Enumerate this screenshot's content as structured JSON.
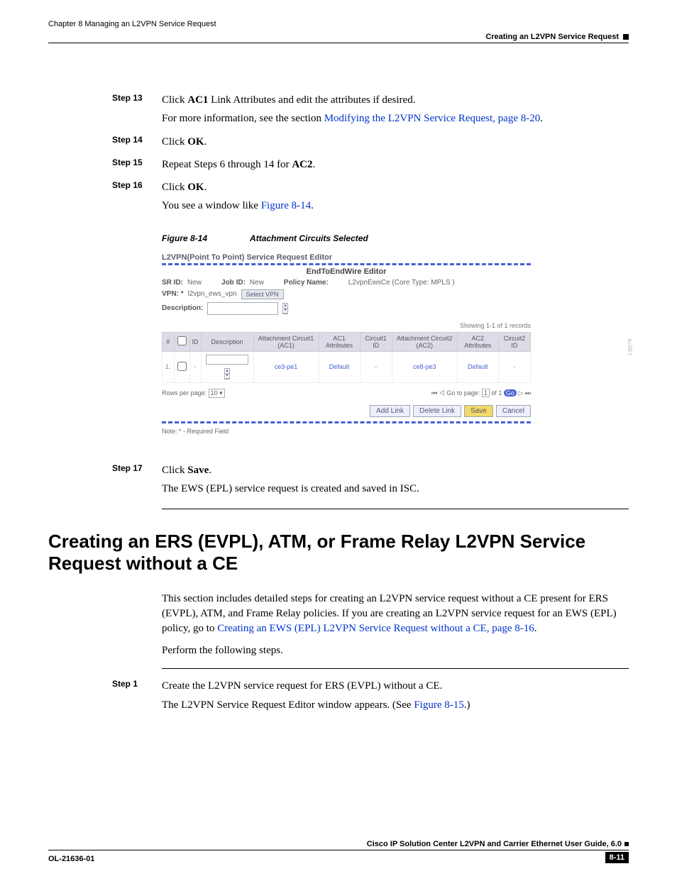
{
  "header": {
    "chapter": "Chapter 8      Managing an L2VPN Service Request",
    "section": "Creating an L2VPN Service Request"
  },
  "steps": {
    "s13": {
      "label": "Step 13",
      "line1a": "Click ",
      "bold1": "AC1",
      "line1b": " Link Attributes and edit the attributes if desired.",
      "line2a": "For more information, see the section ",
      "link": "Modifying the L2VPN Service Request, page 8-20",
      "line2b": "."
    },
    "s14": {
      "label": "Step 14",
      "txt": "Click ",
      "bold": "OK",
      "end": "."
    },
    "s15": {
      "label": "Step 15",
      "txt": "Repeat Steps 6 through 14 for ",
      "bold": "AC2",
      "end": "."
    },
    "s16": {
      "label": "Step 16",
      "txt": "Click ",
      "bold": "OK",
      "end": ".",
      "line2a": "You see a window like ",
      "link": "Figure 8-14",
      "line2b": "."
    },
    "s17": {
      "label": "Step 17",
      "txt": "Click ",
      "bold": "Save",
      "end": ".",
      "line2": "The EWS (EPL) service request is created and saved in ISC."
    },
    "sa1": {
      "label": "Step 1",
      "line1": "Create the L2VPN service request for ERS (EVPL) without a CE.",
      "line2a": "The L2VPN Service Request Editor window appears. (See ",
      "link": "Figure 8-15",
      "line2b": ".)"
    }
  },
  "figure": {
    "caption_no": "Figure 8-14",
    "caption_title": "Attachment Circuits Selected",
    "title": "L2VPN(Point To Point) Service Request Editor",
    "wire": "EndToEndWire Editor",
    "srid_l": "SR ID:",
    "srid_v": "New",
    "jobid_l": "Job ID:",
    "jobid_v": "New",
    "policy_l": "Policy Name:",
    "policy_v": "L2vpnEwsCe (Core Type: MPLS )",
    "vpn_l": "VPN: *",
    "vpn_v": "l2vpn_ews_vpn",
    "vpn_btn": "Select VPN",
    "desc_l": "Description:",
    "showing": "Showing 1-1 of 1 records",
    "th": {
      "h1": "#",
      "h2": "",
      "h3": "ID",
      "h4": "Description",
      "h5": "Attachment Circuit1 (AC1)",
      "h6": "AC1 Attributes",
      "h7": "Circuit1 ID",
      "h8": "Attachment Circuit2 (AC2)",
      "h9": "AC2 Attributes",
      "h10": "Circuit2 ID"
    },
    "row": {
      "c1": "1.",
      "c3": "-",
      "c5": "ce3-pe1",
      "c6": "Default",
      "c7": "-",
      "c8": "ce8-pe3",
      "c9": "Default",
      "c10": "-"
    },
    "rpp_l": "Rows per page:",
    "rpp_v": "10",
    "goto_l": "Go to page:",
    "goto_v": "1",
    "goto_of": "of 1",
    "btn_add": "Add Link",
    "btn_del": "Delete Link",
    "btn_save": "Save",
    "btn_cancel": "Cancel",
    "note": "Note: * - Required Field",
    "sidenum": "138579"
  },
  "h1": "Creating an ERS (EVPL), ATM, or Frame Relay L2VPN Service Request without a CE",
  "para": {
    "p1a": "This section includes detailed steps for creating an L2VPN service request without a CE present for ERS (EVPL), ATM, and Frame Relay policies. If you are creating an L2VPN service request for an EWS (EPL) policy, go to ",
    "p1link": "Creating an EWS (EPL) L2VPN Service Request without a CE, page 8-16",
    "p1b": ".",
    "p2": "Perform the following steps."
  },
  "footer": {
    "title": "Cisco IP Solution Center L2VPN and Carrier Ethernet User Guide, 6.0",
    "doc": "OL-21636-01",
    "page": "8-11"
  }
}
